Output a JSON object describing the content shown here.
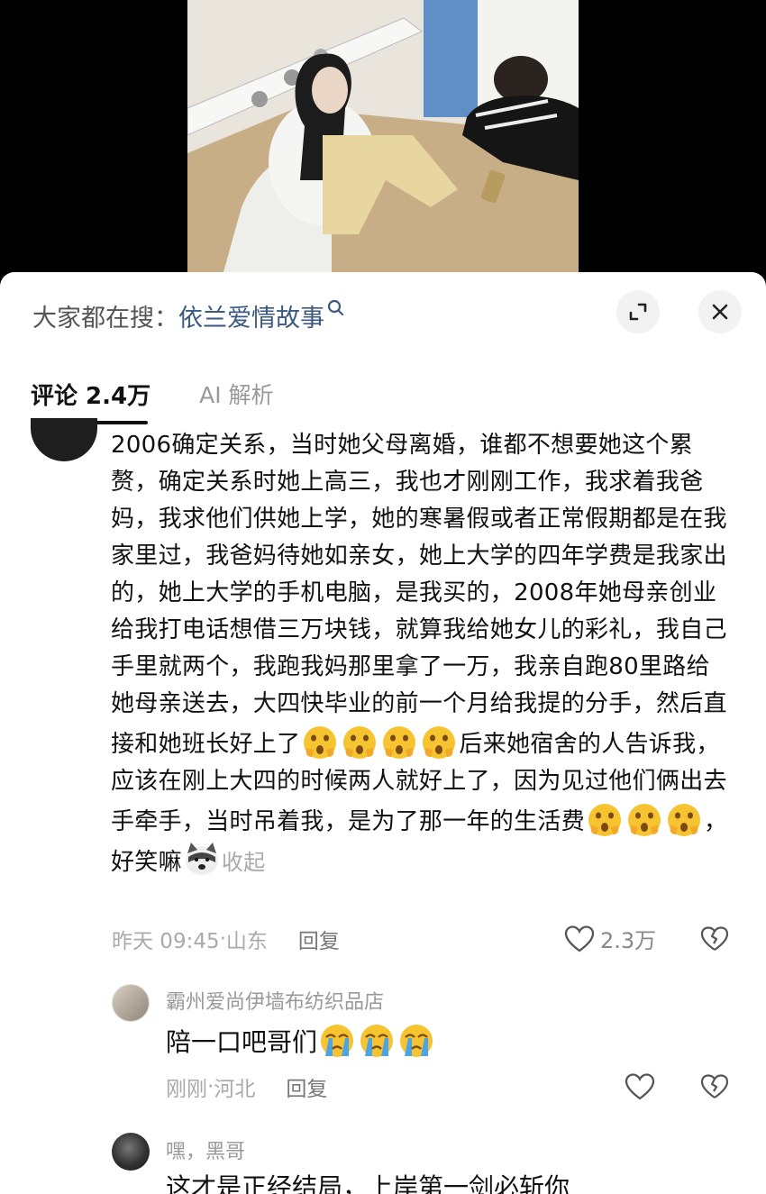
{
  "search": {
    "prefix": "大家都在搜：",
    "term": "依兰爱情故事"
  },
  "tabs": {
    "comments": "评论 2.4万",
    "ai": "AI 解析"
  },
  "main_comment": {
    "text_part1": "2006确定关系，当时她父母离婚，谁都不想要她这个累赘，确定关系时她上高三，我也才刚刚工作，我求着我爸妈，我求他们供她上学，她的寒暑假或者正常假期都是在我家里过，我爸妈待她如亲女，她上大学的四年学费是我家出的，她上大学的手机电脑，是我买的，2008年她母亲创业给我打电话想借三万块钱，就算我给她女儿的彩礼，我自己手里就两个，我跑我妈那里拿了一万，我亲自跑80里路给她母亲送去，大四快毕业的前一个月给我提的分手，然后直接和她班长好上了",
    "text_part2": "后来她宿舍的人告诉我，应该在刚上大四的时候两人就好上了，因为见过他们俩出去手牵手，当时吊着我，是为了那一年的生活费",
    "text_part3": "，好笑嘛",
    "collapse": "收起",
    "time": "昨天 09:45",
    "location": "山东",
    "reply": "回复",
    "likes": "2.3万"
  },
  "reply1": {
    "name": "霸州爱尚伊墙布纺织品店",
    "text": "陪一口吧哥们",
    "time": "刚刚",
    "location": "河北",
    "reply": "回复"
  },
  "reply2": {
    "name": "嘿，黑哥",
    "text": "这才是正经结局，上岸第一剑必斩你"
  },
  "separator": " · ",
  "icons": {
    "search": "search-icon",
    "expand": "expand-icon",
    "close": "close-icon",
    "like": "heart-outline-icon",
    "dislike": "broken-heart-icon",
    "emoji_surprised": "surprised-face-emoji",
    "emoji_crying": "crying-face-emoji",
    "emoji_doge": "doge-emoji"
  }
}
